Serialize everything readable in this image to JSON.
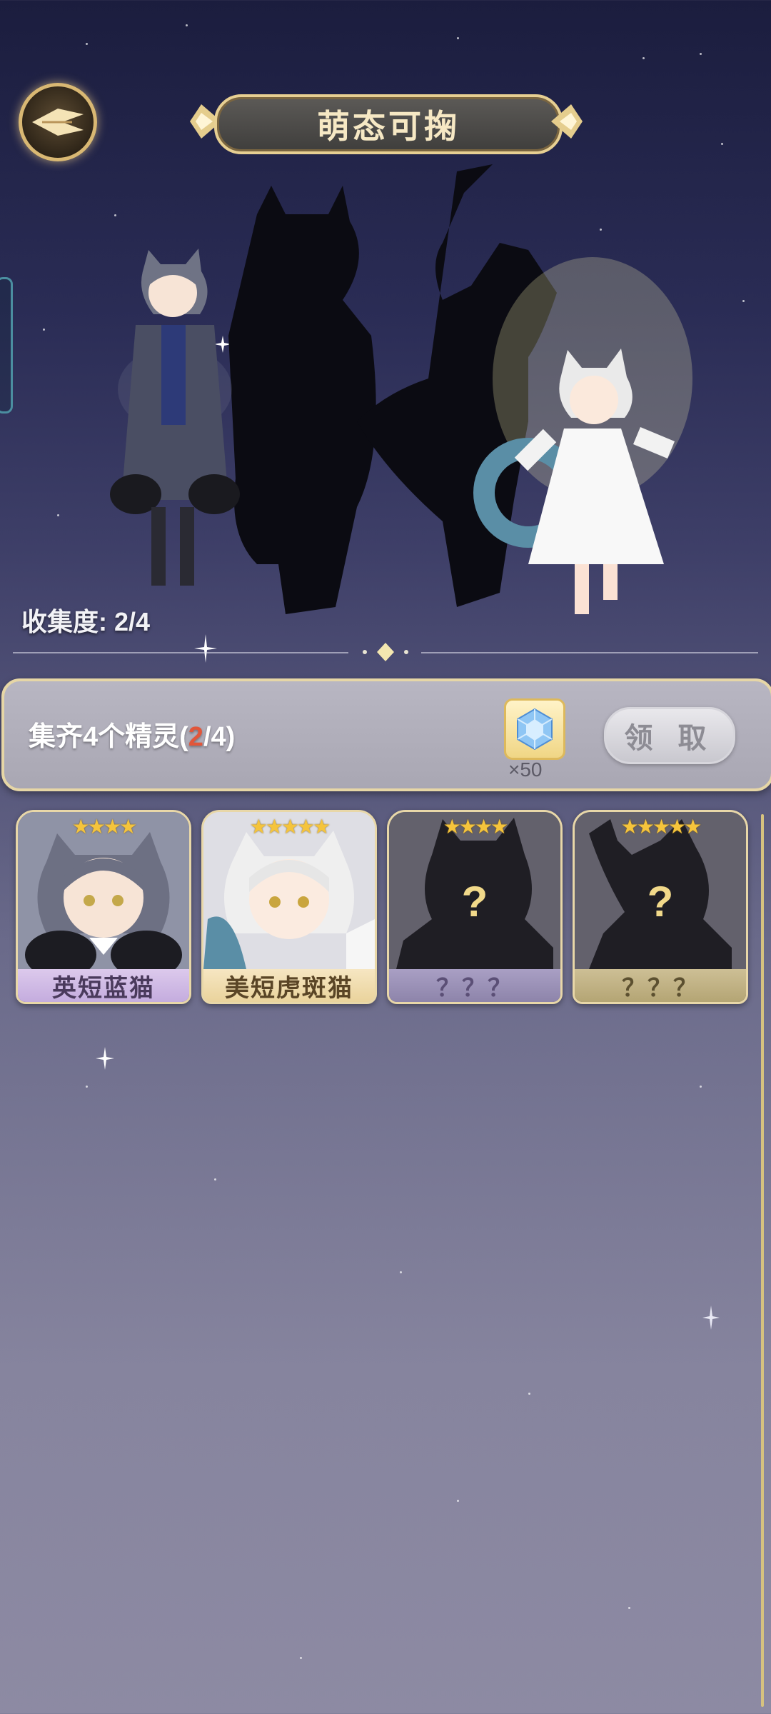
{
  "header": {
    "title": "萌态可掬"
  },
  "collection": {
    "progress_label": "收集度:",
    "progress_value": "2/4"
  },
  "reward": {
    "text_prefix": "集齐4个精灵(",
    "collected": "2",
    "text_suffix": "/4)",
    "item_icon": "crystal-gem-icon",
    "item_quantity": "×50",
    "claim_label": "领 取"
  },
  "cards": [
    {
      "name": "英短蓝猫",
      "stars": "★★★★",
      "unlocked": true,
      "style": "blue-cat"
    },
    {
      "name": "美短虎斑猫",
      "stars": "★★★★★",
      "unlocked": true,
      "style": "tabby-cat"
    },
    {
      "name": "？？？",
      "stars": "★★★★",
      "unlocked": false,
      "hint": "?"
    },
    {
      "name": "？？？",
      "stars": "★★★★★",
      "unlocked": false,
      "hint": "?"
    }
  ],
  "colors": {
    "accent_gold": "#e8d7a8",
    "highlight_red": "#e2563a",
    "name_bar_purple": "#c9b3de",
    "name_bar_gold": "#f1dcae"
  }
}
